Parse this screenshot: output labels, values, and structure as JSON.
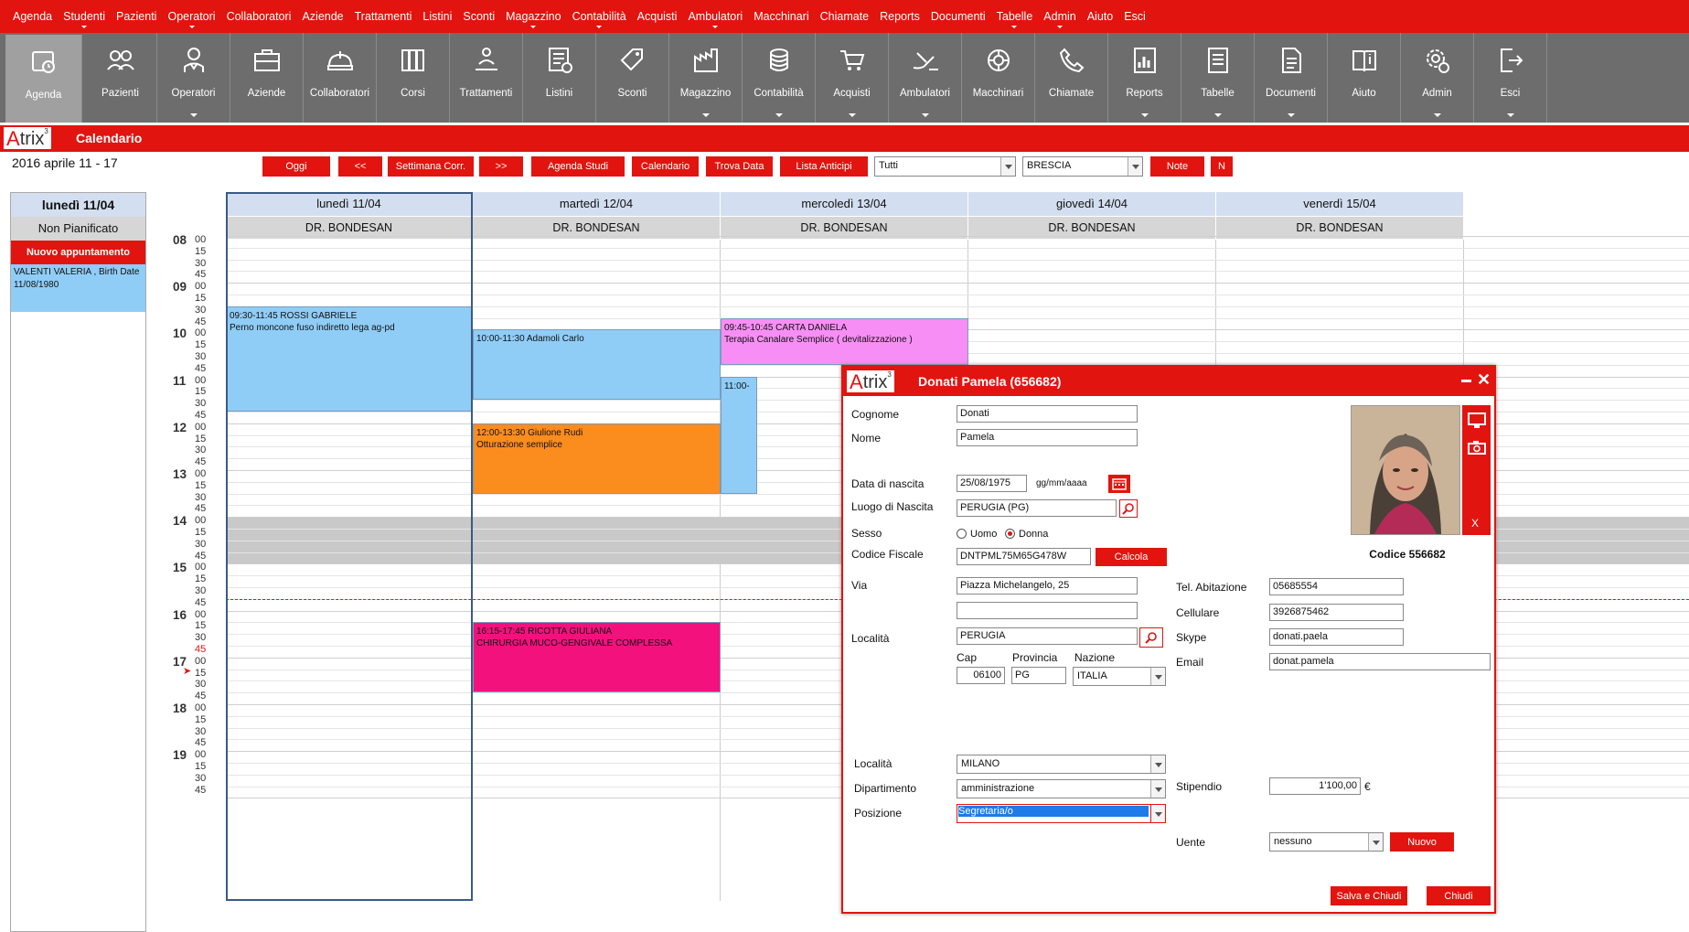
{
  "menu": [
    "Agenda",
    "Studenti",
    "Pazienti",
    "Operatori",
    "Collaboratori",
    "Aziende",
    "Trattamenti",
    "Listini",
    "Sconti",
    "Magazzino",
    "Contabilità",
    "Acquisti",
    "Ambulatori",
    "Macchinari",
    "Chiamate",
    "Reports",
    "Documenti",
    "Tabelle",
    "Admin",
    "Aiuto",
    "Esci"
  ],
  "toolbar": [
    {
      "label": "Agenda",
      "icon": "agenda-icon"
    },
    {
      "label": "Pazienti",
      "icon": "patients-icon"
    },
    {
      "label": "Operatori",
      "icon": "operator-icon"
    },
    {
      "label": "Aziende",
      "icon": "briefcase-icon"
    },
    {
      "label": "Collaboratori",
      "icon": "collaborators-icon"
    },
    {
      "label": "Corsi",
      "icon": "books-icon"
    },
    {
      "label": "Trattamenti",
      "icon": "treatment-icon"
    },
    {
      "label": "Listini",
      "icon": "price-list-icon"
    },
    {
      "label": "Sconti",
      "icon": "discount-icon"
    },
    {
      "label": "Magazzino",
      "icon": "warehouse-icon"
    },
    {
      "label": "Contabilità",
      "icon": "coins-icon"
    },
    {
      "label": "Acquisti",
      "icon": "cart-icon"
    },
    {
      "label": "Ambulatori",
      "icon": "clinic-icon"
    },
    {
      "label": "Macchinari",
      "icon": "machine-icon"
    },
    {
      "label": "Chiamate",
      "icon": "phone-icon"
    },
    {
      "label": "Reports",
      "icon": "report-icon"
    },
    {
      "label": "Tabelle",
      "icon": "table-icon"
    },
    {
      "label": "Documenti",
      "icon": "document-icon"
    },
    {
      "label": "Aiuto",
      "icon": "help-icon"
    },
    {
      "label": "Admin",
      "icon": "admin-gear-icon"
    },
    {
      "label": "Esci",
      "icon": "exit-icon"
    }
  ],
  "app": {
    "logo_a": "A",
    "logo_rest": "trix",
    "logo_sup": "3",
    "title": "Calendario"
  },
  "date_range": "2016 aprile 11 - 17",
  "nav": {
    "today": "Oggi",
    "prev": "<<",
    "current_week": "Settimana Corr.",
    "next": ">>",
    "agenda_studi": "Agenda Studi",
    "calendar": "Calendario",
    "find_date": "Trova Data",
    "advance_list": "Lista Anticipi",
    "filter_value": "Tutti",
    "location_value": "BRESCIA",
    "notes": "Note",
    "n": "N"
  },
  "left_panel": {
    "date": "lunedì 11/04",
    "unplanned": "Non Pianificato",
    "new_appointment": "Nuovo appuntamento",
    "appointment_text": "VALENTI VALERIA , Birth Date 11/08/1980"
  },
  "hours": [
    "08",
    "09",
    "10",
    "11",
    "12",
    "13",
    "14",
    "15",
    "16",
    "17",
    "18",
    "19"
  ],
  "minutes": [
    "00",
    "15",
    "30",
    "45"
  ],
  "days": [
    {
      "name": "lunedì 11/04",
      "doctor": "DR. BONDESAN"
    },
    {
      "name": "martedì 12/04",
      "doctor": "DR. BONDESAN"
    },
    {
      "name": "mercoledì 13/04",
      "doctor": "DR. BONDESAN"
    },
    {
      "name": "giovedì 14/04",
      "doctor": "DR. BONDESAN"
    },
    {
      "name": "venerdì 15/04",
      "doctor": "DR. BONDESAN"
    }
  ],
  "appointments": [
    {
      "line1": "09:30-11:45 ROSSI GABRIELE",
      "line2": "Perno moncone fuso indiretto lega ag-pd",
      "color": "#8fcdf7"
    },
    {
      "line1": "10:00-11:30 Adamoli Carlo",
      "line2": "",
      "color": "#8fcdf7"
    },
    {
      "line1": "12:00-13:30 Giulione Rudi",
      "line2": "Otturazione semplice",
      "color": "#fb8c1e"
    },
    {
      "line1": "16:15-17:45 RICOTTA GIULIANA",
      "line2": "CHIRURGIA MUCO-GENGIVALE COMPLESSA",
      "color": "#f3117e"
    },
    {
      "line1": "09:45-10:45 CARTA DANIELA",
      "line2": "Terapia Canalare Semplice  ( devitalizzazione )",
      "color": "#f78ef5"
    },
    {
      "line1": "11:00-",
      "line2": "",
      "color": "#8fcdf7"
    },
    {
      "line1": "",
      "line2": "",
      "color": "#8c8c21"
    }
  ],
  "modal": {
    "title": "Donati Pamela (656682)",
    "labels": {
      "surname": "Cognome",
      "name": "Nome",
      "birth_date": "Data di nascita",
      "birth_place": "Luogo di Nascita",
      "sex": "Sesso",
      "male": "Uomo",
      "female": "Donna",
      "tax_code": "Codice Fiscale",
      "address": "Via",
      "town": "Località",
      "cap": "Cap",
      "province": "Provincia",
      "nation": "Nazione",
      "home_phone": "Tel. Abitazione",
      "mobile": "Cellulare",
      "skype": "Skype",
      "email": "Email",
      "location": "Località",
      "department": "Dipartimento",
      "position": "Posizione",
      "salary": "Stipendio",
      "user": "Uente",
      "date_format": "gg/mm/aaaa",
      "code_caption": "Codice 556682"
    },
    "values": {
      "surname": "Donati",
      "name": "Pamela",
      "birth_date": "25/08/1975",
      "birth_place": "PERUGIA (PG)",
      "tax_code": "DNTPML75M65G478W",
      "address1": "Piazza Michelangelo, 25",
      "address2": "",
      "town": "PERUGIA",
      "cap": "06100",
      "province": "PG",
      "nation": "ITALIA",
      "home_phone": "05685554",
      "mobile": "3926875462",
      "skype": "donati.paela",
      "email": "donat.pamela",
      "location": "MILANO",
      "department": "amministrazione",
      "position": "Segretaria/o",
      "salary": "1'100,00",
      "currency": "€",
      "user": "nessuno"
    },
    "buttons": {
      "calculate": "Calcola",
      "new": "Nuovo",
      "save_close": "Salva e Chiudi",
      "close": "Chiudi",
      "photo_remove": "X"
    }
  }
}
